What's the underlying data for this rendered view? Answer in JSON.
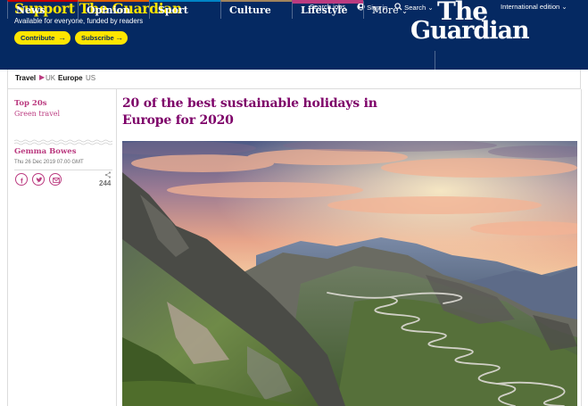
{
  "header": {
    "support_title": "Support The Guardian",
    "support_subtitle": "Available for everyone, funded by readers",
    "contribute_label": "Contribute",
    "subscribe_label": "Subscribe",
    "search_jobs": "Search jobs",
    "sign_in": "Sign in",
    "search": "Search",
    "edition": "International edition",
    "logo_line1": "The",
    "logo_line2": "Guardian"
  },
  "nav": {
    "items": [
      {
        "label": "News",
        "color": "#c70000"
      },
      {
        "label": "Opinion",
        "color": "#e05e00"
      },
      {
        "label": "Sport",
        "color": "#0084c6"
      },
      {
        "label": "Culture",
        "color": "#a1845c"
      },
      {
        "label": "Lifestyle",
        "color": "#bb3b80",
        "active": true
      },
      {
        "label": "More"
      }
    ]
  },
  "breadcrumb": {
    "items": [
      "Travel",
      "UK",
      "Europe",
      "US"
    ]
  },
  "article": {
    "series": "Top 20s",
    "section": "Green travel",
    "byline": "Gemma Bowes",
    "date": "Thu 26 Dec 2019 07.00 GMT",
    "share_count": "244",
    "headline": "20 of the best sustainable holidays in Europe for 2020",
    "hero_image": "mountain-pass-sunset"
  },
  "colors": {
    "brand_blue": "#052962",
    "support_yellow": "#ffe500",
    "lifestyle_pink": "#bb3b80",
    "headline_purple": "#7d0068"
  }
}
